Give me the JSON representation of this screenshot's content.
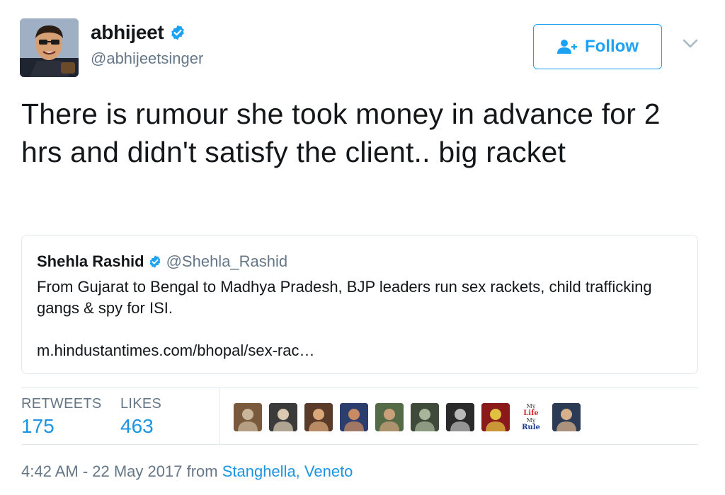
{
  "author": {
    "display_name": "abhijeet",
    "handle": "@abhijeetsinger",
    "verified_icon": "verified-badge-icon"
  },
  "follow_button": {
    "label": "Follow",
    "icon": "follow-person-plus-icon"
  },
  "tweet": {
    "text": "There is rumour she took money in advance for 2 hrs and didn't satisfy the client.. big racket"
  },
  "quoted_tweet": {
    "display_name": "Shehla Rashid",
    "handle": "@Shehla_Rashid",
    "text": "From Gujarat to Bengal to Madhya Pradesh, BJP leaders run sex rackets, child trafficking gangs & spy for ISI.",
    "link": "m.hindustantimes.com/bhopal/sex-rac…"
  },
  "stats": {
    "retweets_label": "RETWEETS",
    "retweets_value": "175",
    "likes_label": "LIKES",
    "likes_value": "463"
  },
  "likers": [
    {
      "kind": "photo",
      "colors": [
        "#7a5a3c",
        "#c9b59a"
      ]
    },
    {
      "kind": "photo",
      "colors": [
        "#3b3b3b",
        "#d8c9b0"
      ]
    },
    {
      "kind": "photo",
      "colors": [
        "#5a3a28",
        "#d9a77a"
      ]
    },
    {
      "kind": "photo",
      "colors": [
        "#2c3e6e",
        "#c78a63"
      ]
    },
    {
      "kind": "photo",
      "colors": [
        "#556b48",
        "#c9a07a"
      ]
    },
    {
      "kind": "photo",
      "colors": [
        "#3f4a3a",
        "#a9b49a"
      ]
    },
    {
      "kind": "photo",
      "colors": [
        "#2a2a2a",
        "#b9b9b9"
      ]
    },
    {
      "kind": "photo",
      "colors": [
        "#8a1a1a",
        "#e0c040"
      ]
    },
    {
      "kind": "text",
      "line1": "My",
      "line2": "Life",
      "line3": "My",
      "line4": "Rule"
    },
    {
      "kind": "photo",
      "colors": [
        "#2b3b55",
        "#d6b08a"
      ]
    }
  ],
  "footer": {
    "timestamp": "4:42 AM - 22 May 2017 from",
    "location": "Stanghella, Veneto"
  },
  "colors": {
    "accent": "#1da1f2",
    "link": "#1b95e0",
    "secondary_text": "#657786",
    "border": "#e1e8ed"
  }
}
